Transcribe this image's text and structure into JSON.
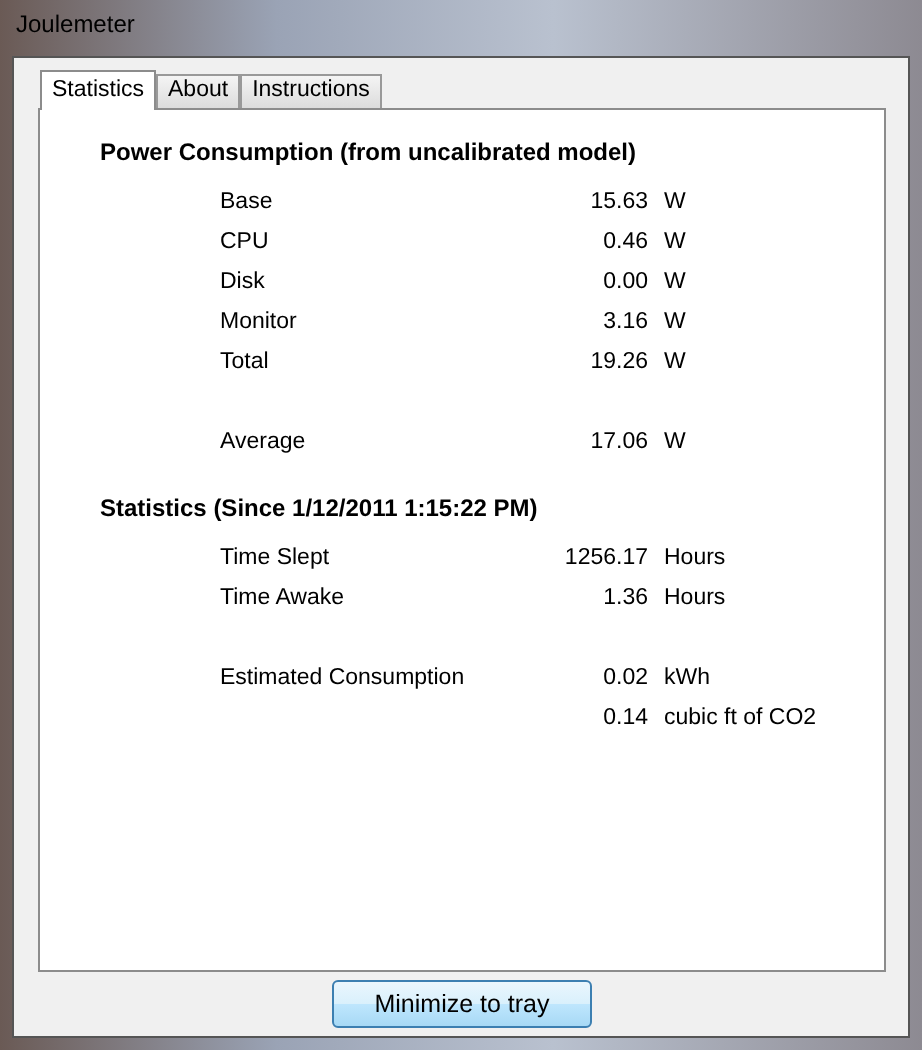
{
  "window": {
    "title": "Joulemeter"
  },
  "tabs": [
    {
      "label": "Statistics",
      "selected": true
    },
    {
      "label": "About",
      "selected": false
    },
    {
      "label": "Instructions",
      "selected": false
    }
  ],
  "sections": [
    {
      "heading": "Power Consumption (from uncalibrated model)",
      "rows": [
        {
          "kind": "row",
          "label": "Base",
          "value": "15.63",
          "unit": "W"
        },
        {
          "kind": "row",
          "label": "CPU",
          "value": "0.46",
          "unit": "W"
        },
        {
          "kind": "row",
          "label": "Disk",
          "value": "0.00",
          "unit": "W"
        },
        {
          "kind": "row",
          "label": "Monitor",
          "value": "3.16",
          "unit": "W"
        },
        {
          "kind": "row",
          "label": "Total",
          "value": "19.26",
          "unit": "W"
        },
        {
          "kind": "spacer"
        },
        {
          "kind": "row",
          "label": "Average",
          "value": "17.06",
          "unit": "W"
        }
      ]
    },
    {
      "heading": "Statistics (Since 1/12/2011 1:15:22 PM)",
      "rows": [
        {
          "kind": "row",
          "label": "Time Slept",
          "value": "1256.17",
          "unit": "Hours"
        },
        {
          "kind": "row",
          "label": "Time Awake",
          "value": "1.36",
          "unit": "Hours"
        },
        {
          "kind": "spacer"
        },
        {
          "kind": "row",
          "label": "Estimated Consumption",
          "value": "0.02",
          "unit": "kWh"
        },
        {
          "kind": "row",
          "value": "0.14",
          "unit": "cubic ft of CO2"
        }
      ]
    }
  ],
  "button": "Minimize to tray"
}
